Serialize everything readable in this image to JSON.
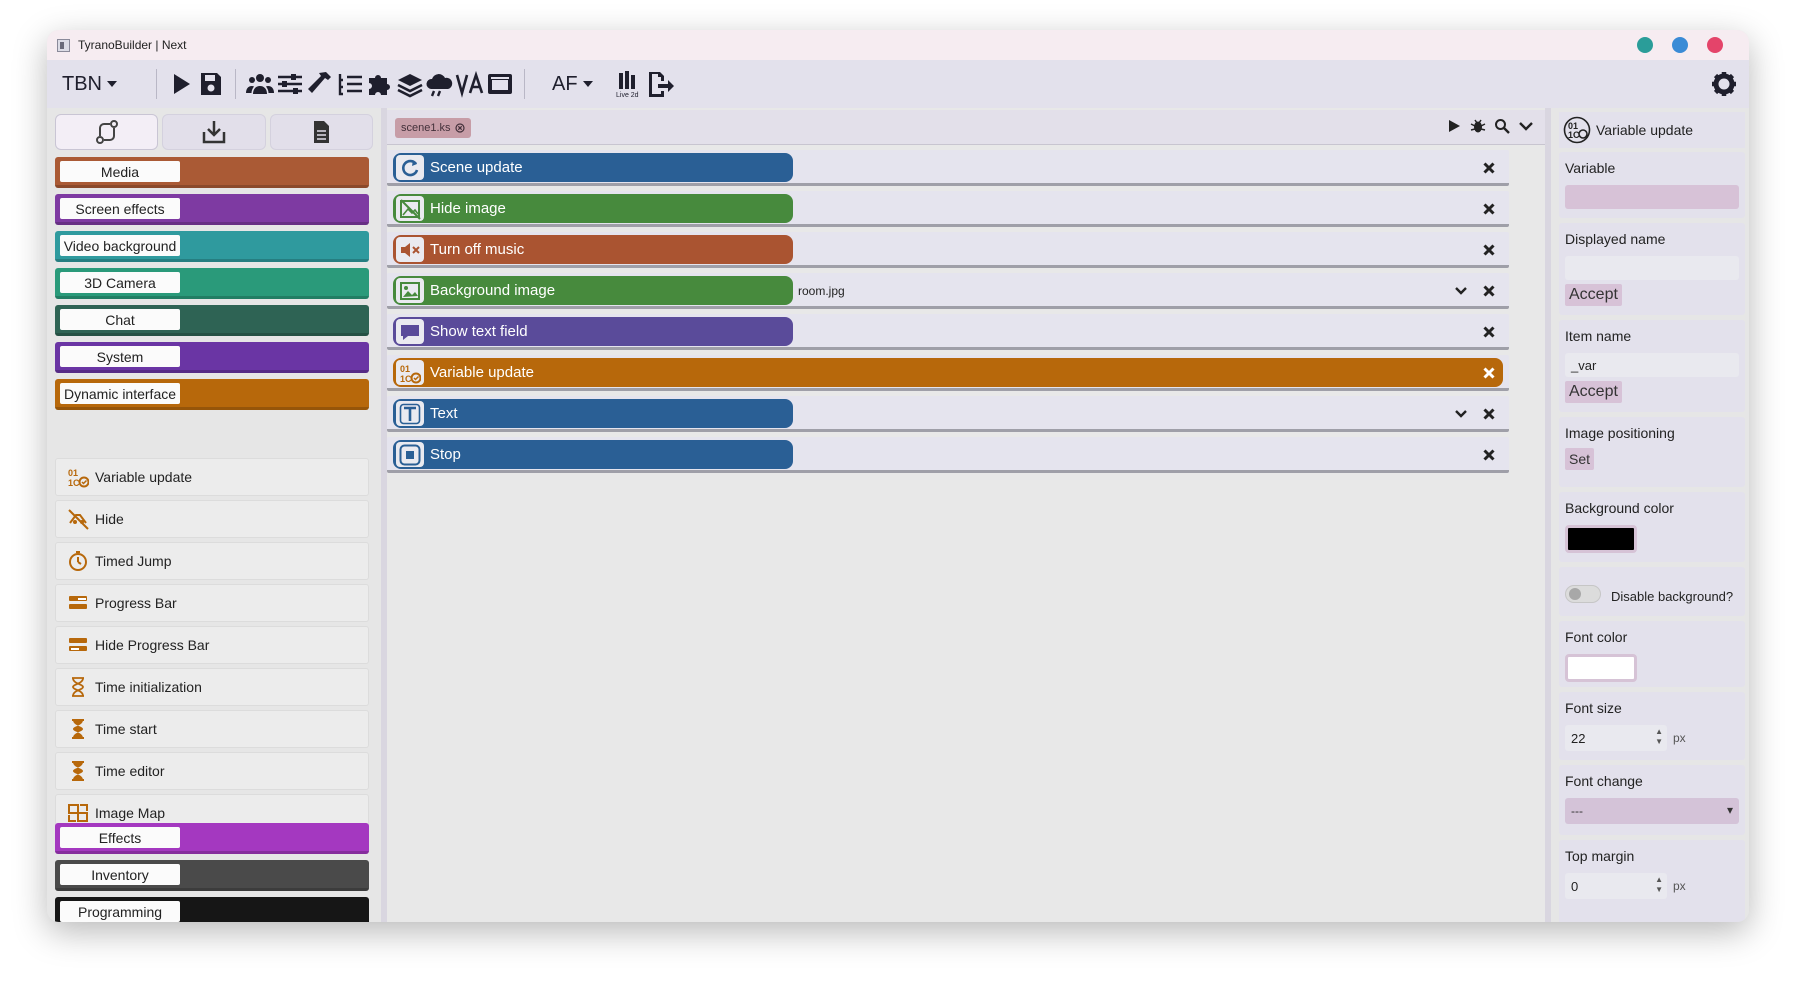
{
  "window": {
    "title": "TyranoBuilder | Next",
    "controls": [
      "#2a9d99",
      "#3a8bd6",
      "#e4446a"
    ]
  },
  "toolbar": {
    "project_menu": "TBN",
    "language_menu": "AF",
    "live2d_label": "Live 2d"
  },
  "sidebar": {
    "categories_top": [
      {
        "label": "Media",
        "color": "#aa5a35"
      },
      {
        "label": "Screen effects",
        "color": "#7e3aa2"
      },
      {
        "label": "Video background",
        "color": "#2f9a9e"
      },
      {
        "label": "3D Camera",
        "color": "#2a9a7a"
      },
      {
        "label": "Chat",
        "color": "#2e6354"
      },
      {
        "label": "System",
        "color": "#6a35a4"
      },
      {
        "label": "Dynamic interface",
        "color": "#b7680b"
      }
    ],
    "items": [
      {
        "label": "Variable update",
        "icon": "variable-update-icon"
      },
      {
        "label": "Hide",
        "icon": "hide-icon"
      },
      {
        "label": "Timed Jump",
        "icon": "timer-icon"
      },
      {
        "label": "Progress Bar",
        "icon": "progress-bar-icon"
      },
      {
        "label": "Hide Progress Bar",
        "icon": "hide-progress-bar-icon"
      },
      {
        "label": "Time initialization",
        "icon": "hourglass-outline-icon"
      },
      {
        "label": "Time start",
        "icon": "hourglass-icon"
      },
      {
        "label": "Time editor",
        "icon": "hourglass-icon"
      },
      {
        "label": "Image Map",
        "icon": "image-map-icon"
      }
    ],
    "categories_bottom": [
      {
        "label": "Effects",
        "color": "#a438c0"
      },
      {
        "label": "Inventory",
        "color": "#4a4a4a"
      },
      {
        "label": "Programming",
        "color": "#161616"
      }
    ]
  },
  "editor": {
    "scene_tab": "scene1.ks",
    "rows": [
      {
        "label": "Scene update",
        "color": "#2a5f95",
        "icon": "refresh-icon",
        "value": "",
        "chevron": false,
        "selected": false
      },
      {
        "label": "Hide image",
        "color": "#478a3d",
        "icon": "hide-image-icon",
        "value": "",
        "chevron": false,
        "selected": false
      },
      {
        "label": "Turn off music",
        "color": "#aa5431",
        "icon": "mute-icon",
        "value": "",
        "chevron": false,
        "selected": false
      },
      {
        "label": "Background image",
        "color": "#478a3d",
        "icon": "image-icon",
        "value": "room.jpg",
        "chevron": true,
        "selected": false
      },
      {
        "label": "Show text field",
        "color": "#5a4b9a",
        "icon": "speech-bubble-icon",
        "value": "",
        "chevron": false,
        "selected": false
      },
      {
        "label": "Variable update",
        "color": "#b7680b",
        "icon": "variable-update-icon",
        "value": "",
        "chevron": false,
        "selected": true
      },
      {
        "label": "Text",
        "color": "#2a5f95",
        "icon": "text-icon",
        "value": "",
        "chevron": true,
        "selected": false
      },
      {
        "label": "Stop",
        "color": "#2a5f95",
        "icon": "stop-icon",
        "value": "",
        "chevron": false,
        "selected": false
      }
    ]
  },
  "properties": {
    "title": "Variable update",
    "variable_label": "Variable",
    "displayed_name_label": "Displayed name",
    "displayed_name_value": "",
    "accept_label": "Accept",
    "item_name_label": "Item name",
    "item_name_value": "_var",
    "image_positioning_label": "Image positioning",
    "set_label": "Set",
    "background_color_label": "Background color",
    "background_color_value": "#000000",
    "disable_background_label": "Disable background?",
    "font_color_label": "Font color",
    "font_color_value": "#ffffff",
    "font_size_label": "Font size",
    "font_size_value": "22",
    "px_unit": "px",
    "font_change_label": "Font change",
    "font_change_value": "---",
    "top_margin_label": "Top margin",
    "top_margin_value": "0"
  }
}
